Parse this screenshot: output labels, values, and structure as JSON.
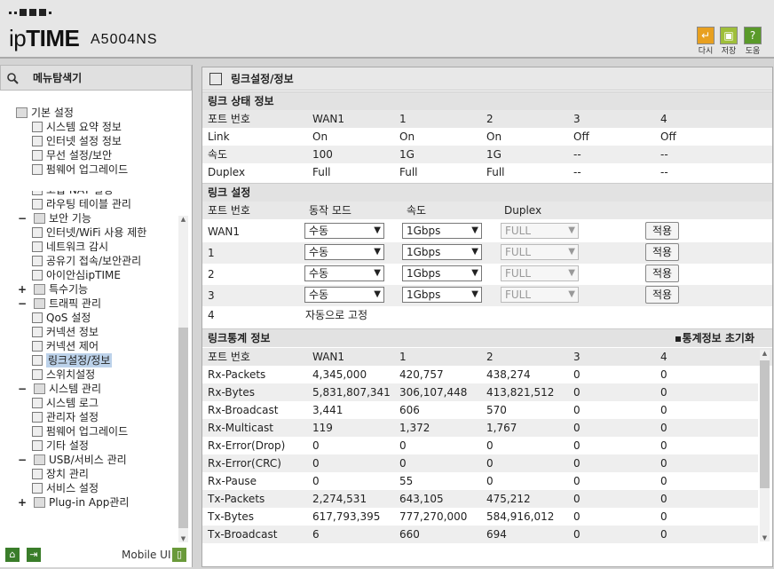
{
  "header": {
    "logo_ip": "ip",
    "logo_time": "TIME",
    "model": "A5004NS",
    "buttons": [
      {
        "label": "다시",
        "icon": "reload-icon",
        "color": "#e8a020"
      },
      {
        "label": "저장",
        "icon": "save-icon",
        "color": "#9fbf3a"
      },
      {
        "label": "도움",
        "icon": "help-icon",
        "color": "#5a9a2a"
      }
    ]
  },
  "sidebar": {
    "title": "메뉴탐색기",
    "tree": [
      {
        "label": "기본 설정",
        "level": 0,
        "toggle": ""
      },
      {
        "label": "시스템 요약 정보",
        "level": 1
      },
      {
        "label": "인터넷 설정 정보",
        "level": 1
      },
      {
        "label": "무선 설정/보안",
        "level": 1
      },
      {
        "label": "펌웨어 업그레이드",
        "level": 1
      },
      {
        "label": "고급 NAT 설정",
        "level": 1
      },
      {
        "label": "라우팅 테이블 관리",
        "level": 1
      },
      {
        "label": "보안 기능",
        "level": 0,
        "toggle": "−"
      },
      {
        "label": "인터넷/WiFi 사용 제한",
        "level": 1
      },
      {
        "label": "네트워크 감시",
        "level": 1
      },
      {
        "label": "공유기 접속/보안관리",
        "level": 1
      },
      {
        "label": "아이안심ipTIME",
        "level": 1
      },
      {
        "label": "특수기능",
        "level": 0,
        "toggle": "+"
      },
      {
        "label": "트래픽 관리",
        "level": 0,
        "toggle": "−"
      },
      {
        "label": "QoS 설정",
        "level": 1
      },
      {
        "label": "커넥션 정보",
        "level": 1
      },
      {
        "label": "커넥션 제어",
        "level": 1
      },
      {
        "label": "링크설정/정보",
        "level": 1,
        "selected": true
      },
      {
        "label": "스위치설정",
        "level": 1
      },
      {
        "label": "시스템 관리",
        "level": 0,
        "toggle": "−"
      },
      {
        "label": "시스템 로그",
        "level": 1
      },
      {
        "label": "관리자 설정",
        "level": 1
      },
      {
        "label": "펌웨어 업그레이드",
        "level": 1
      },
      {
        "label": "기타 설정",
        "level": 1
      },
      {
        "label": "USB/서비스 관리",
        "level": 0,
        "toggle": "−"
      },
      {
        "label": "장치 관리",
        "level": 1
      },
      {
        "label": "서비스 설정",
        "level": 1
      },
      {
        "label": "Plug-in App관리",
        "level": 0,
        "toggle": "+"
      }
    ],
    "mobile_ui": "Mobile UI"
  },
  "main": {
    "title": "링크설정/정보",
    "status": {
      "title": "링크 상태 정보",
      "headers": [
        "포트 번호",
        "WAN1",
        "1",
        "2",
        "3",
        "4"
      ],
      "rows": [
        [
          "Link",
          "On",
          "On",
          "On",
          "Off",
          "Off"
        ],
        [
          "속도",
          "100",
          "1G",
          "1G",
          "--",
          "--"
        ],
        [
          "Duplex",
          "Full",
          "Full",
          "Full",
          "--",
          "--"
        ]
      ]
    },
    "settings": {
      "title": "링크 설정",
      "headers": [
        "포트 번호",
        "동작 모드",
        "속도",
        "Duplex"
      ],
      "rows": [
        {
          "port": "WAN1",
          "mode": "수동",
          "speed": "1Gbps",
          "duplex": "FULL",
          "apply": "적용"
        },
        {
          "port": "1",
          "mode": "수동",
          "speed": "1Gbps",
          "duplex": "FULL",
          "apply": "적용"
        },
        {
          "port": "2",
          "mode": "수동",
          "speed": "1Gbps",
          "duplex": "FULL",
          "apply": "적용"
        },
        {
          "port": "3",
          "mode": "수동",
          "speed": "1Gbps",
          "duplex": "FULL",
          "apply": "적용"
        }
      ],
      "fixed_row": {
        "port": "4",
        "text": "자동으로 고정"
      }
    },
    "stats": {
      "title": "링크통계 정보",
      "reset": "통계정보 초기화",
      "headers": [
        "포트 번호",
        "WAN1",
        "1",
        "2",
        "3",
        "4"
      ],
      "rows": [
        [
          "Rx-Packets",
          "4,345,000",
          "420,757",
          "438,274",
          "0",
          "0"
        ],
        [
          "Rx-Bytes",
          "5,831,807,341",
          "306,107,448",
          "413,821,512",
          "0",
          "0"
        ],
        [
          "Rx-Broadcast",
          "3,441",
          "606",
          "570",
          "0",
          "0"
        ],
        [
          "Rx-Multicast",
          "119",
          "1,372",
          "1,767",
          "0",
          "0"
        ],
        [
          "Rx-Error(Drop)",
          "0",
          "0",
          "0",
          "0",
          "0"
        ],
        [
          "Rx-Error(CRC)",
          "0",
          "0",
          "0",
          "0",
          "0"
        ],
        [
          "Rx-Pause",
          "0",
          "55",
          "0",
          "0",
          "0"
        ],
        [
          "Tx-Packets",
          "2,274,531",
          "643,105",
          "475,212",
          "0",
          "0"
        ],
        [
          "Tx-Bytes",
          "617,793,395",
          "777,270,000",
          "584,916,012",
          "0",
          "0"
        ],
        [
          "Tx-Broadcast",
          "6",
          "660",
          "694",
          "0",
          "0"
        ]
      ]
    }
  }
}
